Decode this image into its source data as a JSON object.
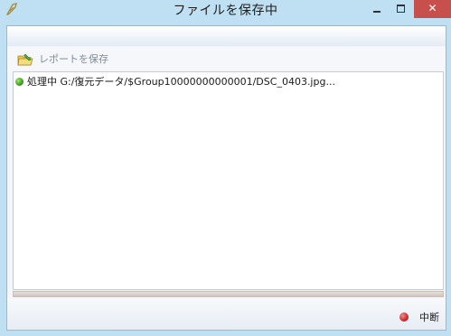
{
  "window": {
    "title": "ファイルを保存中",
    "close_glyph": "✕"
  },
  "toolbar": {
    "save_report_label": "レポートを保存",
    "save_report_icon": "folder-save-icon"
  },
  "log": {
    "entries": [
      {
        "status": "running",
        "status_color": "#2f8d16",
        "text": "処理中 G:/復元データ/$Group10000000000001/DSC_0403.jpg..."
      }
    ]
  },
  "footer": {
    "abort_label": "中断",
    "abort_icon_color": "#c21c1c"
  }
}
